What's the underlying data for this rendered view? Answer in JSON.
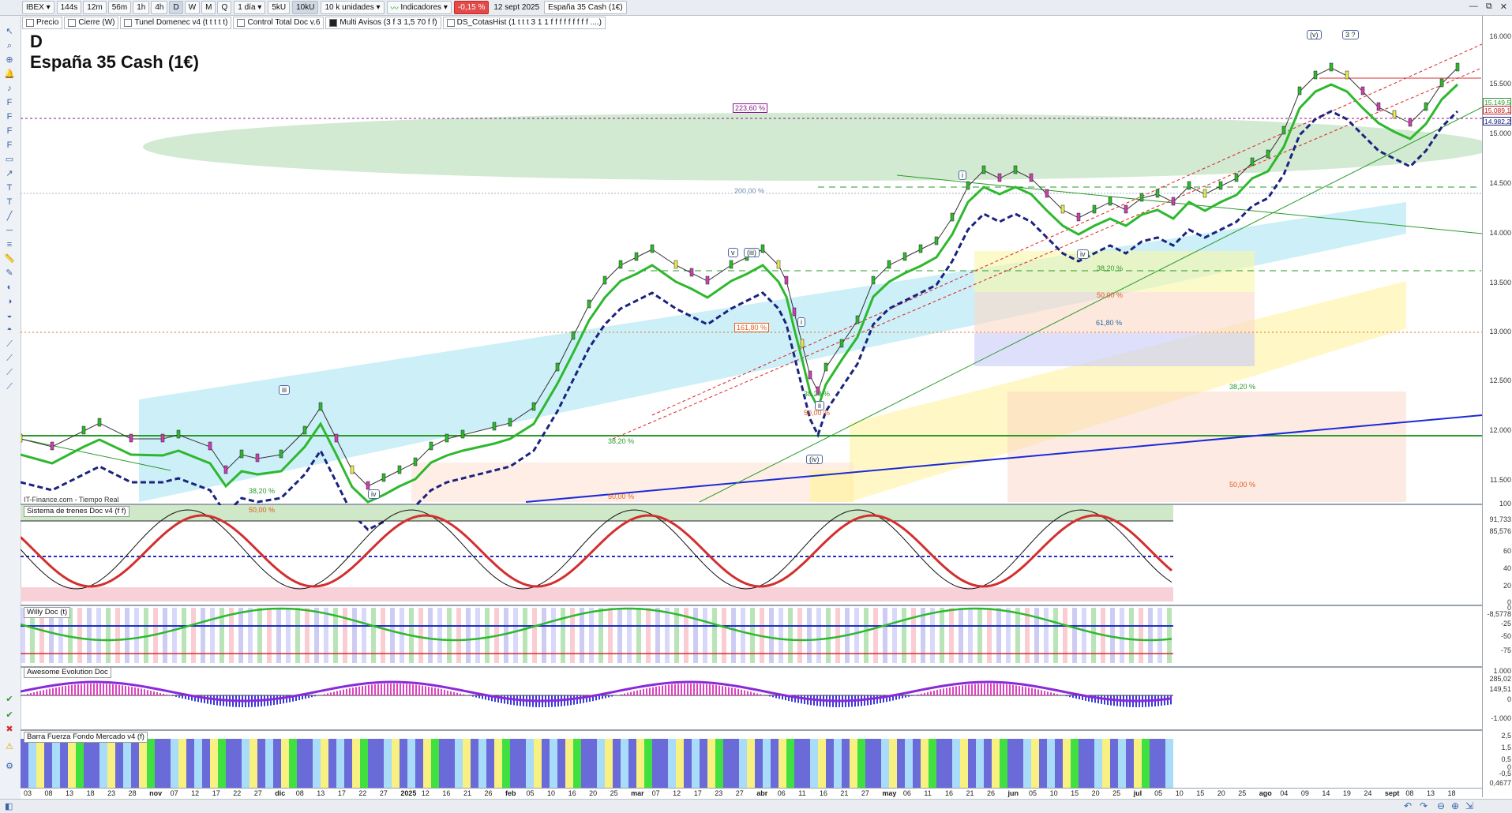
{
  "toolbar": {
    "symbol": "IBEX",
    "timeframes": [
      "144s",
      "12m",
      "56m",
      "1h",
      "4h",
      "D",
      "W",
      "M",
      "Q"
    ],
    "period": "1 día",
    "buttons2": [
      "5kU",
      "10kU"
    ],
    "units": "10 k unidades",
    "indicators_label": "Indicadores",
    "change": "-0,15 %",
    "date": "12 sept 2025",
    "instrument": "España 35 Cash (1€)"
  },
  "indicator_bar": [
    "Precio",
    "Cierre (W)",
    "Tunel Domenec v4 (t t t t t)",
    "Control Total Doc v.6",
    "Multi Avisos (3 f 3 1,5 70 f f)",
    "DS_CotasHist (1 t t t 3 1 1 f f f f f f f f f ....)"
  ],
  "chart_header": {
    "period_letter": "D",
    "title": "España 35 Cash (1€)"
  },
  "source_label": "IT-Finance.com - Tiempo Real",
  "panels": {
    "trenes": "Sistema de trenes Doc v4 (f f)",
    "willy": "Willy Doc (t)",
    "awesome": "Awesome Evolution Doc",
    "barra": "Barra Fuerza Fondo Mercado v4 (f)"
  },
  "price_axis": [
    "16.000",
    "15.500",
    "15.000",
    "14.500",
    "14.000",
    "13.500",
    "13.000",
    "12.500",
    "12.000",
    "11.500"
  ],
  "price_tags": [
    {
      "text": "15.149,5",
      "color": "#2a9a2a"
    },
    {
      "text": "15.089,1",
      "color": "#c02020"
    },
    {
      "text": "14.982,2",
      "color": "#1a237e"
    }
  ],
  "trenes_axis": [
    "100",
    "91,733",
    "85,576",
    "60",
    "40",
    "20",
    "0"
  ],
  "willy_axis": [
    "0",
    "-8,5778",
    "-25",
    "-50",
    "-75"
  ],
  "awesome_axis": [
    "1.000",
    "285,02",
    "149,51",
    "0",
    "-1.000"
  ],
  "barra_axis": [
    "2,5",
    "1,5",
    "0,5",
    "0",
    "-0,5",
    "0,4677"
  ],
  "wave_labels": [
    "iv",
    "iii",
    "v",
    "(iii)",
    "i",
    "(iv)",
    "ii",
    "i",
    "iv",
    "(v)",
    "3 ?"
  ],
  "fib_labels": [
    "223,60 %",
    "200,00 %",
    "161,80 %",
    "38,20 %",
    "50,00 %",
    "61,80 %",
    "38,20 %",
    "50,00 %",
    "38,20 %",
    "50,00 %",
    "38,20 %",
    "50,00 %",
    "38,20 %",
    "50,00 %"
  ],
  "x_axis": [
    {
      "t": "03",
      "b": false
    },
    {
      "t": "08",
      "b": false
    },
    {
      "t": "13",
      "b": false
    },
    {
      "t": "18",
      "b": false
    },
    {
      "t": "23",
      "b": false
    },
    {
      "t": "28",
      "b": false
    },
    {
      "t": "nov",
      "b": true
    },
    {
      "t": "07",
      "b": false
    },
    {
      "t": "12",
      "b": false
    },
    {
      "t": "17",
      "b": false
    },
    {
      "t": "22",
      "b": false
    },
    {
      "t": "27",
      "b": false
    },
    {
      "t": "dic",
      "b": true
    },
    {
      "t": "08",
      "b": false
    },
    {
      "t": "13",
      "b": false
    },
    {
      "t": "17",
      "b": false
    },
    {
      "t": "22",
      "b": false
    },
    {
      "t": "27",
      "b": false
    },
    {
      "t": "2025",
      "b": true
    },
    {
      "t": "12",
      "b": false
    },
    {
      "t": "16",
      "b": false
    },
    {
      "t": "21",
      "b": false
    },
    {
      "t": "26",
      "b": false
    },
    {
      "t": "feb",
      "b": true
    },
    {
      "t": "05",
      "b": false
    },
    {
      "t": "10",
      "b": false
    },
    {
      "t": "16",
      "b": false
    },
    {
      "t": "20",
      "b": false
    },
    {
      "t": "25",
      "b": false
    },
    {
      "t": "mar",
      "b": true
    },
    {
      "t": "07",
      "b": false
    },
    {
      "t": "12",
      "b": false
    },
    {
      "t": "17",
      "b": false
    },
    {
      "t": "23",
      "b": false
    },
    {
      "t": "27",
      "b": false
    },
    {
      "t": "abr",
      "b": true
    },
    {
      "t": "06",
      "b": false
    },
    {
      "t": "11",
      "b": false
    },
    {
      "t": "16",
      "b": false
    },
    {
      "t": "21",
      "b": false
    },
    {
      "t": "27",
      "b": false
    },
    {
      "t": "may",
      "b": true
    },
    {
      "t": "06",
      "b": false
    },
    {
      "t": "11",
      "b": false
    },
    {
      "t": "16",
      "b": false
    },
    {
      "t": "21",
      "b": false
    },
    {
      "t": "26",
      "b": false
    },
    {
      "t": "jun",
      "b": true
    },
    {
      "t": "05",
      "b": false
    },
    {
      "t": "10",
      "b": false
    },
    {
      "t": "15",
      "b": false
    },
    {
      "t": "20",
      "b": false
    },
    {
      "t": "25",
      "b": false
    },
    {
      "t": "jul",
      "b": true
    },
    {
      "t": "05",
      "b": false
    },
    {
      "t": "10",
      "b": false
    },
    {
      "t": "15",
      "b": false
    },
    {
      "t": "20",
      "b": false
    },
    {
      "t": "25",
      "b": false
    },
    {
      "t": "ago",
      "b": true
    },
    {
      "t": "04",
      "b": false
    },
    {
      "t": "09",
      "b": false
    },
    {
      "t": "14",
      "b": false
    },
    {
      "t": "19",
      "b": false
    },
    {
      "t": "24",
      "b": false
    },
    {
      "t": "sept",
      "b": true
    },
    {
      "t": "08",
      "b": false
    },
    {
      "t": "13",
      "b": false
    },
    {
      "t": "18",
      "b": false
    }
  ],
  "colors": {
    "up": "#2eb82e",
    "down": "#d32f2f",
    "avg": "#1a237e",
    "accent": "#3a64a8"
  }
}
